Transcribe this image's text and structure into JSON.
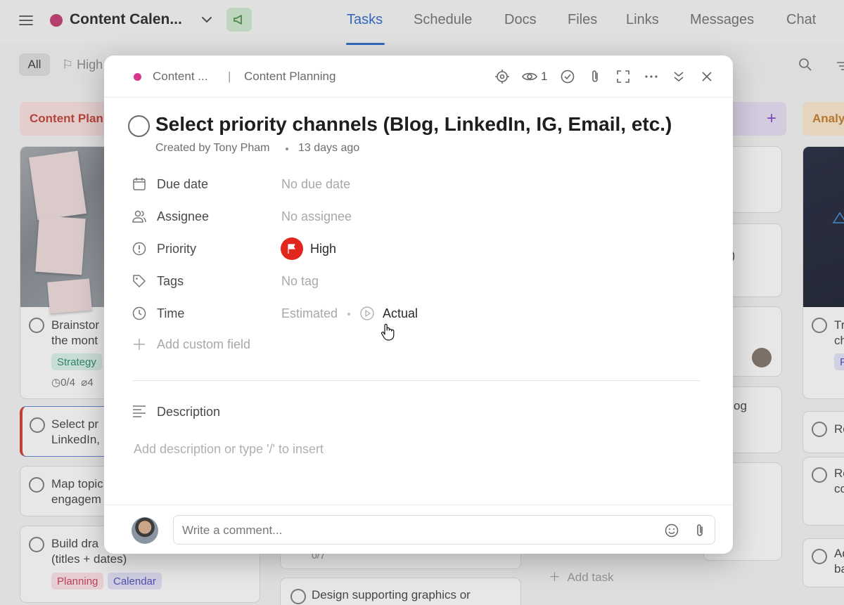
{
  "app": {
    "project_title": "Content Calen...",
    "nav": [
      "Tasks",
      "Schedule",
      "Docs",
      "Files",
      "Links",
      "Messages",
      "Chat"
    ],
    "active_tab": "Tasks",
    "filter_all": "All",
    "filter_high": "High"
  },
  "board": {
    "columns": [
      {
        "label": "Content Plan",
        "color": "#fbe0e0",
        "text_color": "#c0392b"
      },
      {
        "label": "Analy",
        "color": "#fde9cf",
        "text_color": "#c2761d"
      }
    ],
    "cards": {
      "c1_line1": "Brainstor",
      "c1_line2": "the mont",
      "c1_tag": "Strategy",
      "c1_subtasks": "0/4",
      "c1_attach": "4",
      "c2_line1": "Select pr",
      "c2_line2": "LinkedIn,",
      "c3_line1": "Map topic",
      "c3_line2": "engagem",
      "c4_line1": "Build dra",
      "c4_line2": "(titles + dates)",
      "c4_tag1": "Planning",
      "c4_tag2": "Calendar",
      "mid_bottom": "Design supporting graphics or",
      "mid_count": "0/7",
      "frag_paren": "y)",
      "frag_log": "og",
      "add_task": "Add task",
      "r1_line1": "Tr",
      "r1_line2": "ch",
      "r1_tag": "P",
      "r2": "Re",
      "r3_line1": "Re",
      "r3_line2": "co",
      "r4_line1": "Ad",
      "r4_line2": "ba"
    }
  },
  "modal": {
    "breadcrumb_project": "Content ...",
    "breadcrumb_separator": "|",
    "breadcrumb_section": "Content Planning",
    "watchers_count": "1",
    "title": "Select priority channels (Blog, LinkedIn, IG, Email, etc.)",
    "created_by": "Created by Tony Pham",
    "created_ago": "13 days ago",
    "fields": {
      "due_date_label": "Due date",
      "due_date_value": "No due date",
      "assignee_label": "Assignee",
      "assignee_value": "No assignee",
      "priority_label": "Priority",
      "priority_value": "High",
      "tags_label": "Tags",
      "tags_value": "No tag",
      "time_label": "Time",
      "time_estimated": "Estimated",
      "time_actual": "Actual",
      "add_custom_field": "Add custom field"
    },
    "description_label": "Description",
    "description_placeholder": "Add description or type '/' to insert",
    "comment_placeholder": "Write a comment...",
    "colors": {
      "priority_red": "#e0261d",
      "project_pink": "#d6368c",
      "accent_blue": "#2563c9"
    }
  }
}
